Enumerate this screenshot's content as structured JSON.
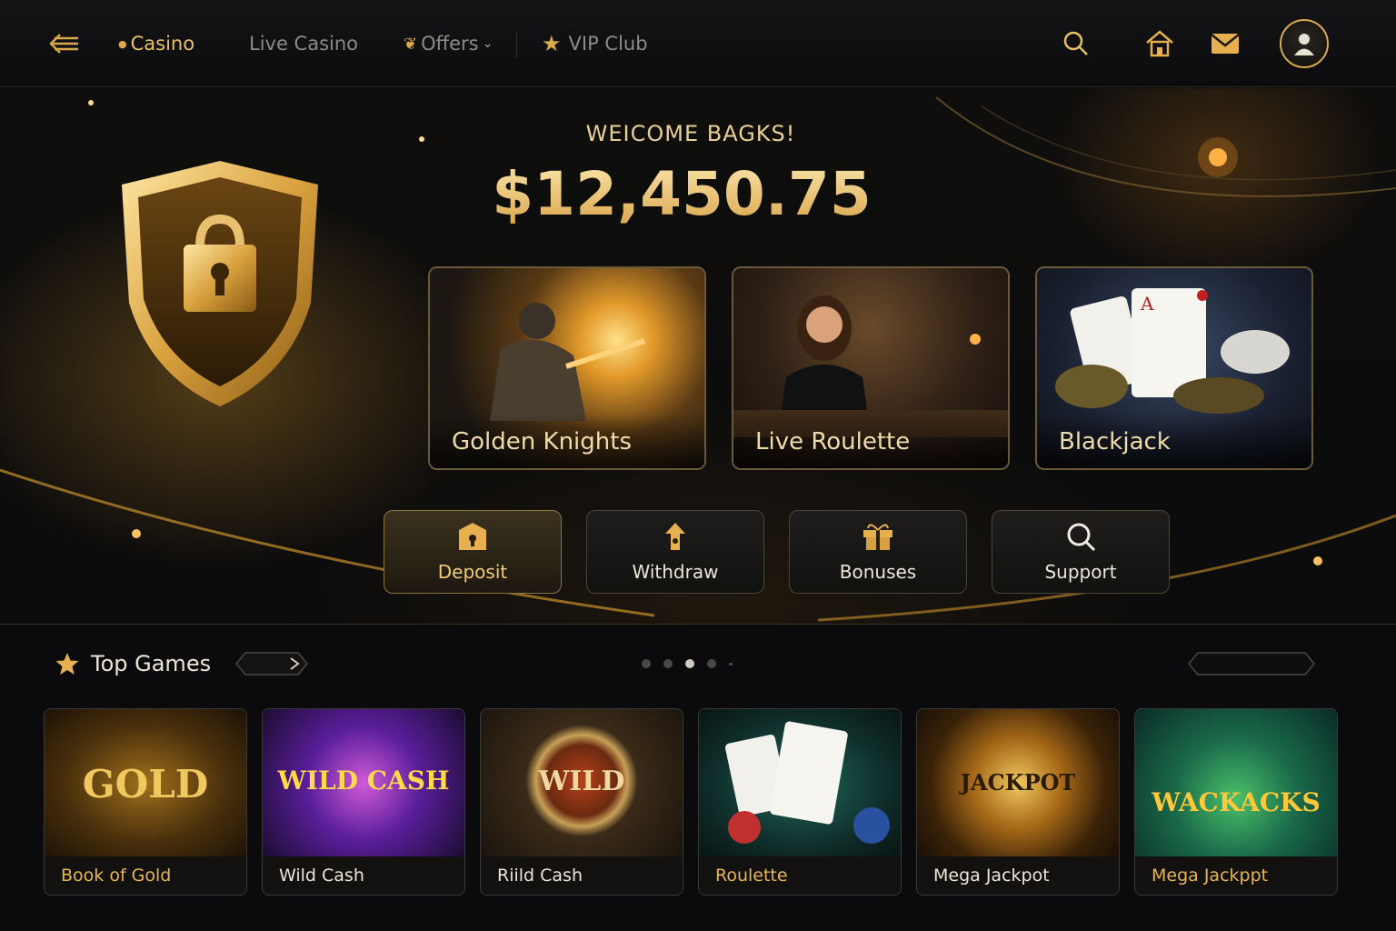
{
  "nav": {
    "menu_icon": "menu-back-icon",
    "items": [
      {
        "label": "Casino",
        "icon": "chip-icon",
        "active": true
      },
      {
        "label": "Live Casino",
        "active": false
      },
      {
        "label": "Offers",
        "icon": "gift-icon",
        "has_dropdown": true,
        "active": false
      },
      {
        "label": "VIP Club",
        "icon": "star-icon",
        "active": false
      }
    ],
    "actions": [
      "search-icon",
      "home-icon",
      "mail-icon",
      "user-avatar"
    ]
  },
  "hero": {
    "welcome": "WEICOME BAGKS!",
    "balance": "$12,450.75",
    "featured": [
      {
        "title": "Golden Knights"
      },
      {
        "title": "Live Roulette"
      },
      {
        "title": "Blackjack"
      }
    ],
    "actions": [
      {
        "label": "Deposit",
        "icon": "wallet-lock-icon"
      },
      {
        "label": "Withdraw",
        "icon": "withdraw-icon"
      },
      {
        "label": "Bonuses",
        "icon": "gift-box-icon"
      },
      {
        "label": "Support",
        "icon": "search-help-icon"
      }
    ]
  },
  "top_games": {
    "title": "Top Games",
    "pagination_dots": 5,
    "active_dots": [
      2
    ],
    "games": [
      {
        "caption": "Book of Gold",
        "art_text": "GOLD"
      },
      {
        "caption": "Wild Cash",
        "art_text": "WILD CASH"
      },
      {
        "caption": "Riild Cash",
        "art_text": "WILD"
      },
      {
        "caption": "Roulette",
        "art_text": ""
      },
      {
        "caption": "Mega Jackpot",
        "art_text": "JACKPOT"
      },
      {
        "caption": "Mega Jackppt",
        "art_text": "WACKACKS"
      }
    ]
  },
  "colors": {
    "accent_gold": "#e6c16a",
    "background": "#0b0b0d",
    "muted_text": "#8e8a84"
  }
}
